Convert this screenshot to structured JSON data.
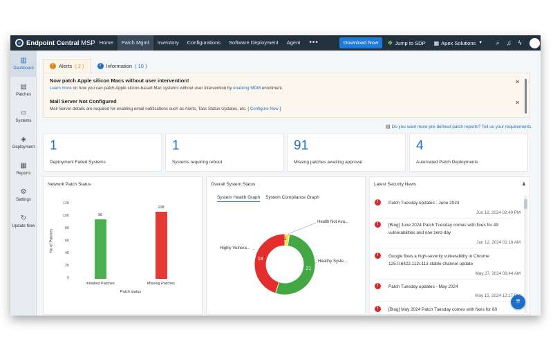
{
  "header": {
    "brand": "Endpoint Central",
    "brand_suffix": "MSP",
    "nav": [
      "Home",
      "Patch Mgmt",
      "Inventory",
      "Configurations",
      "Software Deployment",
      "Agent"
    ],
    "active_nav": "Patch Mgmt",
    "more": "•••",
    "download_button": "Download Now",
    "jump_link": "Jump to SDP",
    "org_selector": "Apex Solutions"
  },
  "sidebar": {
    "items": [
      {
        "label": "Dashboard",
        "icon": "dashboard-icon",
        "glyph": "▥",
        "active": true
      },
      {
        "label": "Patches",
        "icon": "patches-icon",
        "glyph": "▤"
      },
      {
        "label": "Systems",
        "icon": "monitor-icon",
        "glyph": "▭"
      },
      {
        "label": "Deployment",
        "icon": "deployment-icon",
        "glyph": "◈"
      },
      {
        "label": "Reports",
        "icon": "reports-icon",
        "glyph": "▦"
      },
      {
        "label": "Settings",
        "icon": "gear-icon",
        "glyph": "⚙"
      },
      {
        "label": "Update Now",
        "icon": "refresh-icon",
        "glyph": "↻"
      }
    ]
  },
  "alerts": {
    "tabs": [
      {
        "label": "Alerts",
        "count": "( 2 )",
        "color": "#e8831e",
        "glyph": "!"
      },
      {
        "label": "Information",
        "count": "( 10 )",
        "color": "#1f6fc7",
        "glyph": "i"
      }
    ],
    "items": [
      {
        "title": "Now patch Apple silicon Macs without user intervention!",
        "link1": "Learn more",
        "text1": " on how you can patch Apple silicon-based Mac systems without user intervention by ",
        "link2": "enabling MDM",
        "text2": " enrollment."
      },
      {
        "title": "Mail Server Not Configured",
        "text1": "Mail Server details are required for enabling email notifications such as Alerts, Task Status Updates, etc. [ ",
        "link1": "Configure Now",
        "text2": " ]"
      }
    ]
  },
  "report_link": "Do you want more pre-defined patch reports? Tell us your requirements.",
  "stats": [
    {
      "value": "1",
      "label": "Deployment Failed Systems"
    },
    {
      "value": "1",
      "label": "Systems requiring reboot"
    },
    {
      "value": "91",
      "label": "Missing patches awaiting approval"
    },
    {
      "value": "4",
      "label": "Automated Patch Deployments"
    }
  ],
  "network_patch_status": {
    "title": "Network Patch Status",
    "chart_data": {
      "type": "bar",
      "categories": [
        "Installed Patches",
        "Missing Patches"
      ],
      "values": [
        96,
        108
      ],
      "colors": [
        "#4cb050",
        "#e53935"
      ],
      "xlabel": "Patch status",
      "ylabel": "No of Patches",
      "ylim": [
        0,
        120
      ],
      "yticks": [
        "120",
        "100",
        "80",
        "60",
        "40",
        "20",
        "0"
      ]
    }
  },
  "overall_status": {
    "title": "Overall System Status",
    "tabs": [
      "System Health Graph",
      "System Compliance Graph"
    ],
    "active_tab": "System Health Graph",
    "chart_data": {
      "type": "pie",
      "labels": [
        "Health Not Ava...",
        "Healthy Syste...",
        "Highly Vulnera..."
      ],
      "values": [
        1,
        21,
        18
      ],
      "colors": [
        "#f4e04d",
        "#43a843",
        "#e42d2d"
      ]
    }
  },
  "news": {
    "title": "Latest Security News",
    "items": [
      {
        "text": "Patch Tuesday updates - June 2024",
        "date": "Jun 12, 2024 02:49 PM"
      },
      {
        "text": "[Blog] June 2024 Patch Tuesday comes with fixes for 49 vulnerabilities and one zero-day",
        "date": "Jun 12, 2024 01:16 AM"
      },
      {
        "text": "Google fixes a high-severity vulnerability in Chrome 125.0.6422.112/.113 stable channel update",
        "date": "May 27, 2024 09:44 AM"
      },
      {
        "text": "Patch Tuesday updates - May 2024",
        "date": "May 15, 2024 12:17 PM"
      },
      {
        "text": "[Blog] May 2024 Patch Tuesday comes with fixes for 60",
        "date": ""
      }
    ]
  }
}
